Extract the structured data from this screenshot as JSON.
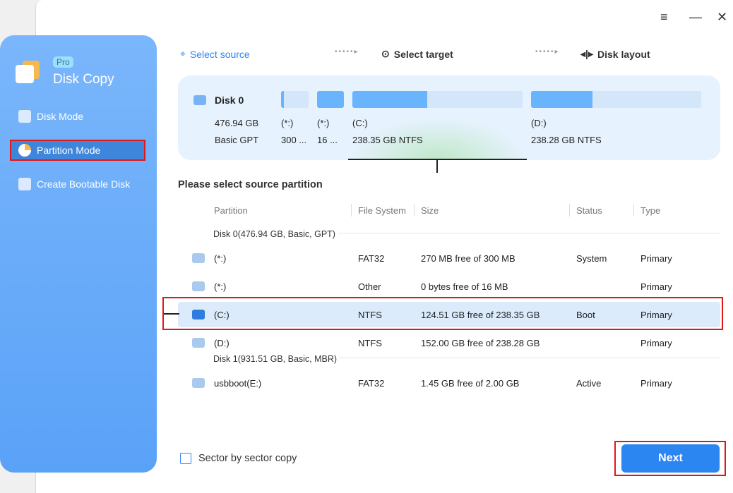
{
  "window": {
    "menu_icon": "hamburger-icon",
    "minimize_icon": "minimize-icon",
    "close_icon": "close-icon"
  },
  "sidebar": {
    "badge": "Pro",
    "title": "Disk Copy",
    "items": [
      {
        "label": "Disk Mode"
      },
      {
        "label": "Partition Mode",
        "active": true
      },
      {
        "label": "Create Bootable Disk"
      }
    ]
  },
  "steps": [
    {
      "label": "Select source",
      "active": true
    },
    {
      "label": "Select target"
    },
    {
      "label": "Disk layout"
    }
  ],
  "disk_map": {
    "name": "Disk 0",
    "size": "476.94 GB",
    "type": "Basic GPT",
    "partitions": [
      {
        "label": "(*:)",
        "detail": "300 ...",
        "used": 0.1
      },
      {
        "label": "(*:)",
        "detail": "16 ...",
        "used": 1.0
      },
      {
        "label": "(C:)",
        "detail": "238.35 GB NTFS",
        "used": 0.44
      },
      {
        "label": "(D:)",
        "detail": "238.28 GB NTFS",
        "used": 0.36
      }
    ]
  },
  "section_title": "Please select source partition",
  "table": {
    "headers": [
      "Partition",
      "File System",
      "Size",
      "Status",
      "Type"
    ],
    "groups": [
      {
        "label": "Disk 0(476.94 GB, Basic, GPT)",
        "rows": [
          [
            "(*:)",
            "FAT32",
            "270 MB free of 300 MB",
            "System",
            "Primary"
          ],
          [
            "(*:)",
            "Other",
            "0 bytes free of 16 MB",
            "",
            "Primary"
          ],
          [
            "(C:)",
            "NTFS",
            "124.51 GB free of 238.35 GB",
            "Boot",
            "Primary"
          ],
          [
            "(D:)",
            "NTFS",
            "152.00 GB free of 238.28 GB",
            "",
            "Primary"
          ]
        ]
      },
      {
        "label": "Disk 1(931.51 GB, Basic, MBR)",
        "rows": [
          [
            "usbboot(E:)",
            "FAT32",
            "1.45 GB free of 2.00 GB",
            "Active",
            "Primary"
          ]
        ]
      }
    ]
  },
  "options": {
    "sector_copy": "Sector by sector copy",
    "sector_copy_checked": false
  },
  "next_label": "Next"
}
